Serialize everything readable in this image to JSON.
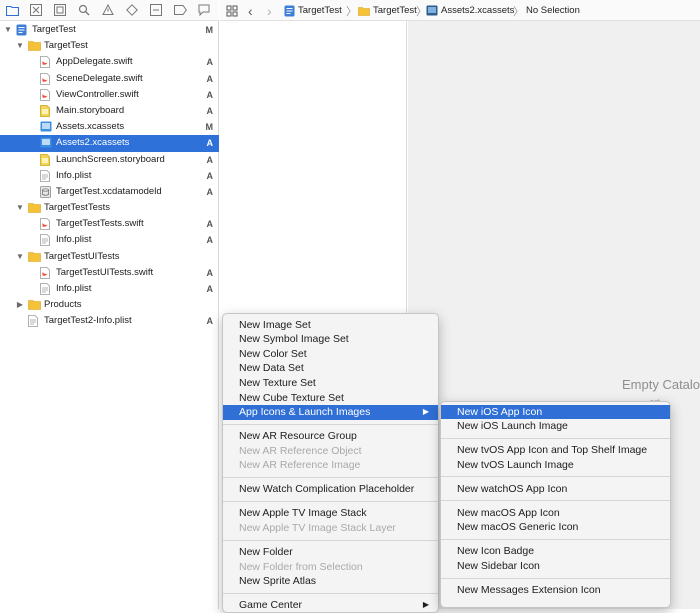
{
  "nav_toolbar_icons": [
    "folder-icon",
    "source-control-icon",
    "symbol-icon",
    "find-icon",
    "issue-icon",
    "test-icon",
    "debug-icon",
    "breakpoint-icon",
    "report-icon"
  ],
  "tree": [
    {
      "name": "TargetTest",
      "status": "M",
      "kind": "project",
      "indent": 0,
      "disclosure": "open"
    },
    {
      "name": "TargetTest",
      "status": "",
      "kind": "folder",
      "indent": 1,
      "disclosure": "open"
    },
    {
      "name": "AppDelegate.swift",
      "status": "A",
      "kind": "swift",
      "indent": 2
    },
    {
      "name": "SceneDelegate.swift",
      "status": "A",
      "kind": "swift",
      "indent": 2
    },
    {
      "name": "ViewController.swift",
      "status": "A",
      "kind": "swift",
      "indent": 2
    },
    {
      "name": "Main.storyboard",
      "status": "A",
      "kind": "storyboard",
      "indent": 2
    },
    {
      "name": "Assets.xcassets",
      "status": "M",
      "kind": "assets",
      "indent": 2
    },
    {
      "name": "Assets2.xcassets",
      "status": "A",
      "kind": "assets",
      "indent": 2,
      "selected": true
    },
    {
      "name": "LaunchScreen.storyboard",
      "status": "A",
      "kind": "storyboard",
      "indent": 2
    },
    {
      "name": "Info.plist",
      "status": "A",
      "kind": "plist",
      "indent": 2
    },
    {
      "name": "TargetTest.xcdatamodeld",
      "status": "A",
      "kind": "datamodel",
      "indent": 2
    },
    {
      "name": "TargetTestTests",
      "status": "",
      "kind": "folder",
      "indent": 1,
      "disclosure": "open"
    },
    {
      "name": "TargetTestTests.swift",
      "status": "A",
      "kind": "swift",
      "indent": 2
    },
    {
      "name": "Info.plist",
      "status": "A",
      "kind": "plist",
      "indent": 2
    },
    {
      "name": "TargetTestUITests",
      "status": "",
      "kind": "folder",
      "indent": 1,
      "disclosure": "open"
    },
    {
      "name": "TargetTestUITests.swift",
      "status": "A",
      "kind": "swift",
      "indent": 2
    },
    {
      "name": "Info.plist",
      "status": "A",
      "kind": "plist",
      "indent": 2
    },
    {
      "name": "Products",
      "status": "",
      "kind": "folder",
      "indent": 1,
      "disclosure": "closed"
    },
    {
      "name": "TargetTest2-Info.plist",
      "status": "A",
      "kind": "plist",
      "indent": 1
    }
  ],
  "jumpbar": {
    "crumbs": [
      "TargetTest",
      "TargetTest",
      "Assets2.xcassets",
      "No Selection"
    ]
  },
  "canvas": {
    "empty_title": "Empty Catalo",
    "empty_sub": "...ert..."
  },
  "context_menu": {
    "items": [
      {
        "label": "New Image Set",
        "disabled": false
      },
      {
        "label": "New Symbol Image Set",
        "disabled": false
      },
      {
        "label": "New Color Set",
        "disabled": false
      },
      {
        "label": "New Data Set",
        "disabled": false
      },
      {
        "label": "New Texture Set",
        "disabled": false
      },
      {
        "label": "New Cube Texture Set",
        "disabled": false
      },
      {
        "label": "App Icons & Launch Images",
        "disabled": false,
        "submenu": true,
        "highlighted": true
      },
      {
        "sep": true
      },
      {
        "label": "New AR Resource Group",
        "disabled": false
      },
      {
        "label": "New AR Reference Object",
        "disabled": true
      },
      {
        "label": "New AR Reference Image",
        "disabled": true
      },
      {
        "sep": true
      },
      {
        "label": "New Watch Complication Placeholder",
        "disabled": false
      },
      {
        "sep": true
      },
      {
        "label": "New Apple TV Image Stack",
        "disabled": false
      },
      {
        "label": "New Apple TV Image Stack Layer",
        "disabled": true
      },
      {
        "sep": true
      },
      {
        "label": "New Folder",
        "disabled": false
      },
      {
        "label": "New Folder from Selection",
        "disabled": true
      },
      {
        "label": "New Sprite Atlas",
        "disabled": false
      },
      {
        "sep": true
      },
      {
        "label": "Game Center",
        "disabled": false,
        "submenu": true
      }
    ]
  },
  "submenu": {
    "items": [
      {
        "label": "New iOS App Icon",
        "highlighted": true
      },
      {
        "label": "New iOS Launch Image"
      },
      {
        "sep": true
      },
      {
        "label": "New tvOS App Icon and Top Shelf Image"
      },
      {
        "label": "New tvOS Launch Image"
      },
      {
        "sep": true
      },
      {
        "label": "New watchOS App Icon"
      },
      {
        "sep": true
      },
      {
        "label": "New macOS App Icon"
      },
      {
        "label": "New macOS Generic Icon"
      },
      {
        "sep": true
      },
      {
        "label": "New Icon Badge"
      },
      {
        "label": "New Sidebar Icon"
      },
      {
        "sep": true
      },
      {
        "label": "New Messages Extension Icon"
      }
    ]
  },
  "colors": {
    "selection": "#2e71d9",
    "menu_highlight": "#2f6fd6",
    "folder": "#f5c136",
    "assets_blue": "#3b8ee0"
  }
}
